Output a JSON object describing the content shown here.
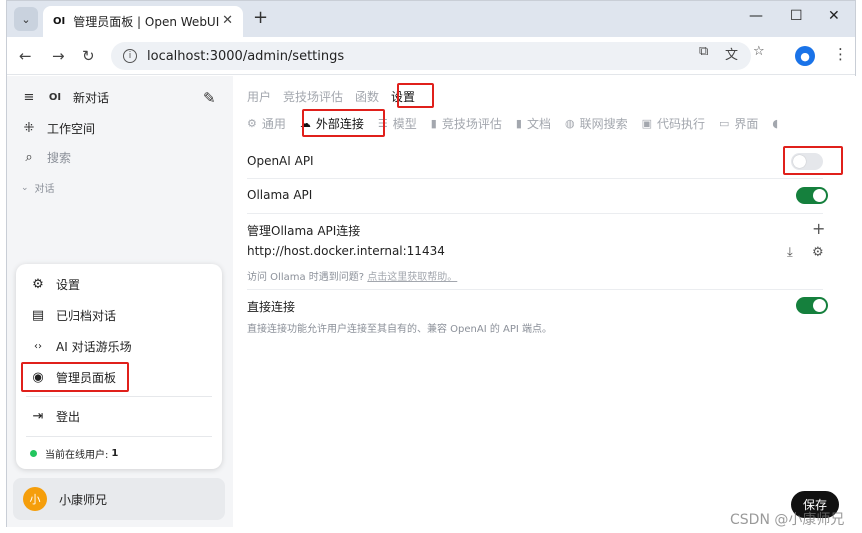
{
  "browser": {
    "tab_title": "管理员面板 | Open WebUI",
    "tab_favicon": "OI",
    "url": "localhost:3000/admin/settings",
    "icons": [
      "tab-list-icon",
      "close-icon",
      "plus-icon",
      "minimize-icon",
      "maximize-icon",
      "close-window-icon",
      "back-icon",
      "forward-icon",
      "reload-icon",
      "info-icon",
      "open-external-icon",
      "translate-icon",
      "star-icon",
      "profile-icon",
      "more-icon"
    ]
  },
  "sidebar": {
    "logo_text": "OI",
    "new_chat": "新对话",
    "workspace": "工作空间",
    "search_placeholder": "搜索",
    "chats_section": "对话",
    "menu": {
      "settings": "设置",
      "archived": "已归档对话",
      "playground": "AI 对话游乐场",
      "admin_panel": "管理员面板",
      "logout": "登出",
      "online_users_label": "当前在线用户:",
      "online_users_count": "1"
    },
    "user": {
      "avatar_letter": "小",
      "name": "小康师兄"
    }
  },
  "main": {
    "top_tabs": [
      "用户",
      "竞技场评估",
      "函数",
      "设置"
    ],
    "active_top_tab": "设置",
    "sub_tabs": [
      {
        "icon": "gear-icon",
        "label": "通用"
      },
      {
        "icon": "cloud-icon",
        "label": "外部连接"
      },
      {
        "icon": "database-icon",
        "label": "模型"
      },
      {
        "icon": "document-icon",
        "label": "竞技场评估"
      },
      {
        "icon": "document-icon",
        "label": "文档"
      },
      {
        "icon": "globe-icon",
        "label": "联网搜索"
      },
      {
        "icon": "terminal-icon",
        "label": "代码执行"
      },
      {
        "icon": "monitor-icon",
        "label": "界面"
      },
      {
        "icon": "speaker-icon",
        "label": ""
      }
    ],
    "active_sub_tab": "外部连接",
    "openai_api": {
      "label": "OpenAI API",
      "enabled": false
    },
    "ollama_api": {
      "label": "Ollama API",
      "enabled": true
    },
    "manage_ollama": {
      "label": "管理Ollama API连接",
      "url": "http://host.docker.internal:11434",
      "help_text": "访问 Ollama 时遇到问题?",
      "help_link": "点击这里获取帮助。"
    },
    "direct_connections": {
      "label": "直接连接",
      "enabled": true,
      "description": "直接连接功能允许用户连接至其自有的、兼容 OpenAI 的 API 端点。"
    },
    "save_label": "保存"
  },
  "watermark": "CSDN @小康师兄",
  "colors": {
    "highlight": "#e0201b",
    "toggle_on": "#15803d",
    "online_dot": "#22c55e",
    "avatar": "#f59e0b"
  }
}
